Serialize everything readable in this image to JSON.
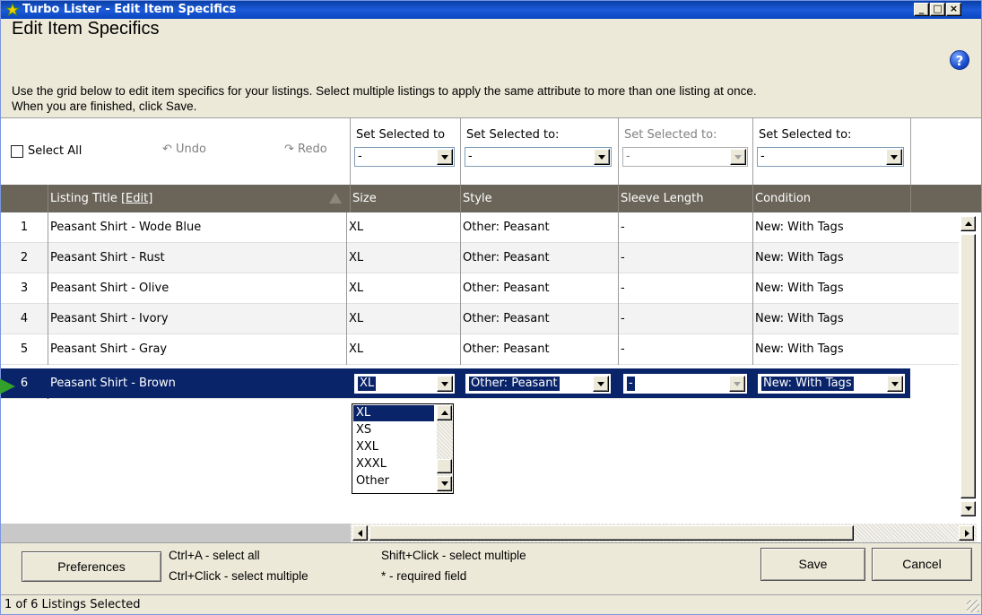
{
  "window": {
    "title": "Turbo Lister - Edit Item Specifics",
    "controls": [
      "minimize",
      "maximize",
      "close"
    ]
  },
  "header": {
    "heading": "Edit Item Specifics",
    "instructions_line1": "Use the grid below to edit item specifics for your listings. Select multiple listings to apply the same attribute to more than one listing at once.",
    "instructions_line2": "When you are finished, click Save.",
    "help_icon": "?"
  },
  "toolbar": {
    "select_all_label": "Select All",
    "undo_label": "Undo",
    "redo_label": "Redo",
    "set_selected": [
      {
        "label": "Set Selected to",
        "value": "-",
        "disabled": false
      },
      {
        "label": "Set Selected to:",
        "value": "-",
        "disabled": false
      },
      {
        "label": "Set Selected to:",
        "value": "-",
        "disabled": true
      },
      {
        "label": "Set Selected to:",
        "value": "-",
        "disabled": false
      }
    ]
  },
  "grid": {
    "columns": {
      "title": "Listing Title",
      "edit_link": "[Edit]",
      "size": "Size",
      "style": "Style",
      "sleeve": "Sleeve Length",
      "condition": "Condition"
    },
    "rows": [
      {
        "num": "1",
        "title": "Peasant Shirt - Wode Blue",
        "size": "XL",
        "style": "Other: Peasant",
        "sleeve": "-",
        "condition": "New: With Tags"
      },
      {
        "num": "2",
        "title": "Peasant Shirt - Rust",
        "size": "XL",
        "style": "Other: Peasant",
        "sleeve": "-",
        "condition": "New: With Tags"
      },
      {
        "num": "3",
        "title": "Peasant Shirt - Olive",
        "size": "XL",
        "style": "Other: Peasant",
        "sleeve": "-",
        "condition": "New: With Tags"
      },
      {
        "num": "4",
        "title": "Peasant Shirt - Ivory",
        "size": "XL",
        "style": "Other: Peasant",
        "sleeve": "-",
        "condition": "New: With Tags"
      },
      {
        "num": "5",
        "title": "Peasant Shirt - Gray",
        "size": "XL",
        "style": "Other: Peasant",
        "sleeve": "-",
        "condition": "New: With Tags"
      },
      {
        "num": "6",
        "title": "Peasant Shirt - Brown",
        "size": "XL",
        "style": "Other: Peasant",
        "sleeve": "-",
        "condition": "New: With Tags"
      }
    ],
    "size_options": [
      "XL",
      "XS",
      "XXL",
      "XXXL",
      "Other"
    ]
  },
  "footer": {
    "preferences_label": "Preferences",
    "hint1": "Ctrl+A - select all",
    "hint2": "Ctrl+Click - select multiple",
    "hint3": "Shift+Click - select multiple",
    "hint4": "* - required field",
    "save_label": "Save",
    "cancel_label": "Cancel"
  },
  "status": {
    "text": "1 of 6 Listings Selected"
  },
  "colors": {
    "titlebar": "#0a46c0",
    "header_row": "#6a6459",
    "selected_row": "#0a246a",
    "row_indicator": "#33a02c"
  }
}
